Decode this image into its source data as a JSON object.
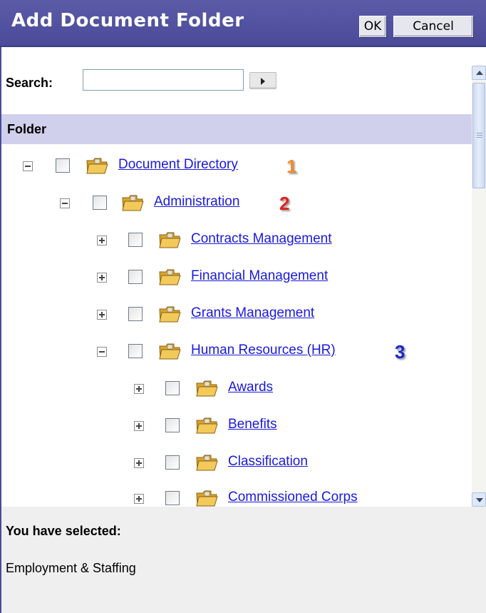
{
  "dialog": {
    "title": "Add Document Folder",
    "ok_label": "OK",
    "cancel_label": "Cancel"
  },
  "search": {
    "label": "Search:",
    "value": "",
    "placeholder": ""
  },
  "tree": {
    "header": "Folder",
    "nodes": [
      {
        "label": "Document Directory",
        "expander": "minus",
        "badge": "1"
      },
      {
        "label": "Administration",
        "expander": "minus",
        "badge": "2"
      },
      {
        "label": "Contracts Management",
        "expander": "plus"
      },
      {
        "label": "Financial Management",
        "expander": "plus"
      },
      {
        "label": "Grants Management",
        "expander": "plus"
      },
      {
        "label": "Human Resources (HR)",
        "expander": "minus",
        "badge": "3"
      },
      {
        "label": "Awards",
        "expander": "plus"
      },
      {
        "label": "Benefits",
        "expander": "plus"
      },
      {
        "label": "Classification",
        "expander": "plus"
      },
      {
        "label": "Commissioned Corps",
        "expander": "plus"
      }
    ]
  },
  "selection": {
    "heading": "You have selected:",
    "value": "Employment & Staffing"
  },
  "colors": {
    "title_bar": "#4a4a99",
    "header_band": "#d0d0ec",
    "link": "#1a1adb",
    "badge_1": "#f28c28",
    "badge_2": "#e0241d",
    "badge_3": "#1a28c9"
  }
}
